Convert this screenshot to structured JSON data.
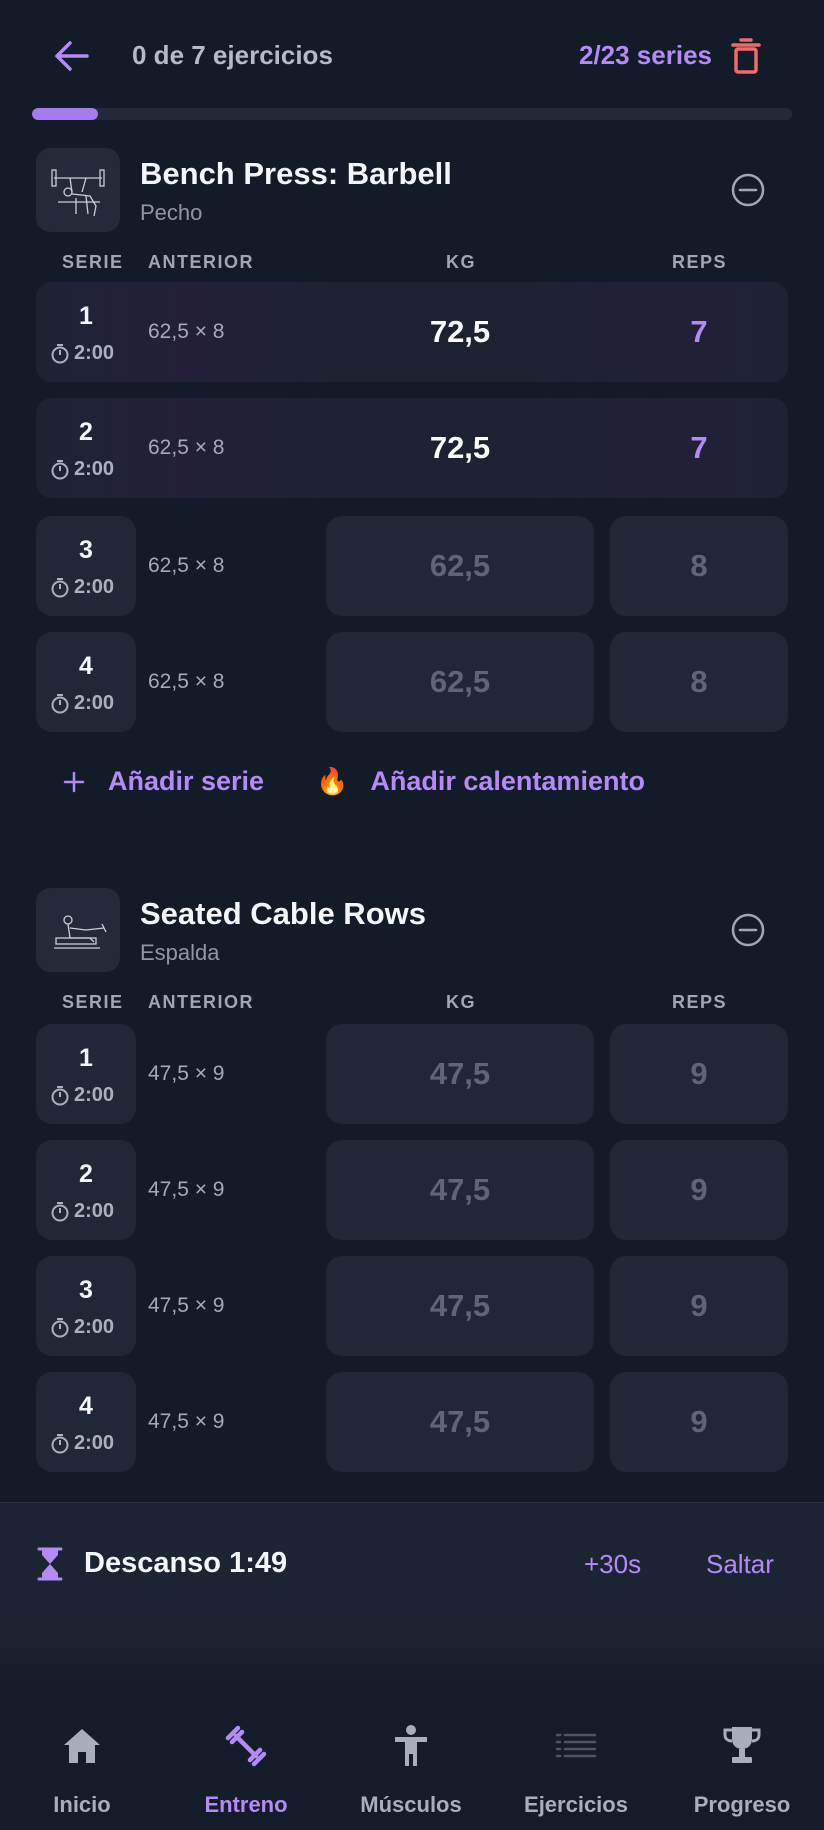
{
  "header": {
    "title": "0 de 7 ejercicios",
    "series": "2/23 series",
    "progress": 0.087
  },
  "exercises": [
    {
      "name": "Bench Press: Barbell",
      "muscle": "Pecho",
      "columns": {
        "serie": "SERIE",
        "anterior": "ANTERIOR",
        "kg": "KG",
        "reps": "REPS"
      },
      "sets": [
        {
          "num": "1",
          "timer": "2:00",
          "prev": "62,5 × 8",
          "kg": "72,5",
          "reps": "7",
          "done": true
        },
        {
          "num": "2",
          "timer": "2:00",
          "prev": "62,5 × 8",
          "kg": "72,5",
          "reps": "7",
          "done": true
        },
        {
          "num": "3",
          "timer": "2:00",
          "prev": "62,5 × 8",
          "kg": "62,5",
          "reps": "8",
          "done": false
        },
        {
          "num": "4",
          "timer": "2:00",
          "prev": "62,5 × 8",
          "kg": "62,5",
          "reps": "8",
          "done": false
        }
      ],
      "add_set": "Añadir serie",
      "add_warmup": "Añadir calentamiento"
    },
    {
      "name": "Seated Cable Rows",
      "muscle": "Espalda",
      "columns": {
        "serie": "SERIE",
        "anterior": "ANTERIOR",
        "kg": "KG",
        "reps": "REPS"
      },
      "sets": [
        {
          "num": "1",
          "timer": "2:00",
          "prev": "47,5 × 9",
          "kg": "47,5",
          "reps": "9",
          "done": false
        },
        {
          "num": "2",
          "timer": "2:00",
          "prev": "47,5 × 9",
          "kg": "47,5",
          "reps": "9",
          "done": false
        },
        {
          "num": "3",
          "timer": "2:00",
          "prev": "47,5 × 9",
          "kg": "47,5",
          "reps": "9",
          "done": false
        },
        {
          "num": "4",
          "timer": "2:00",
          "prev": "47,5 × 9",
          "kg": "47,5",
          "reps": "9",
          "done": false
        }
      ]
    }
  ],
  "rest": {
    "label": "Descanso 1:49",
    "add_time": "+30s",
    "skip": "Saltar"
  },
  "nav": {
    "items": [
      {
        "label": "Inicio",
        "icon": "home-icon",
        "active": false
      },
      {
        "label": "Entreno",
        "icon": "dumbbell-icon",
        "active": true
      },
      {
        "label": "Músculos",
        "icon": "body-icon",
        "active": false
      },
      {
        "label": "Ejercicios",
        "icon": "list-icon",
        "active": false
      },
      {
        "label": "Progreso",
        "icon": "trophy-icon",
        "active": false
      }
    ]
  },
  "colors": {
    "accent": "#b48af5",
    "danger": "#f06a6a",
    "background": "#131a28",
    "card": "#202838"
  }
}
